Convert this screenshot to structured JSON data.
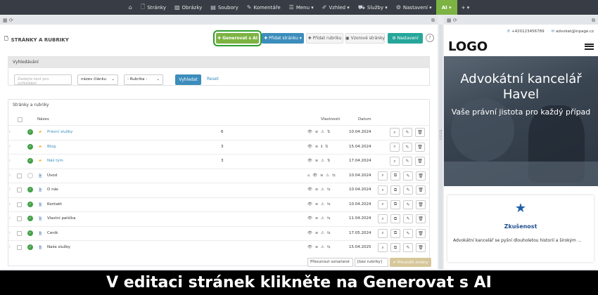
{
  "topbar": {
    "home_icon": "home-icon",
    "items": [
      {
        "label": "Stránky",
        "icon": "file-icon"
      },
      {
        "label": "Obrázky",
        "icon": "image-icon"
      },
      {
        "label": "Soubory",
        "icon": "folder-icon"
      },
      {
        "label": "Komentáře",
        "icon": "comment-icon"
      },
      {
        "label": "Menu ▾",
        "icon": "menu-icon"
      },
      {
        "label": "Vzhled ▾",
        "icon": "brush-icon"
      },
      {
        "label": "Služby ▾",
        "icon": "truck-icon"
      },
      {
        "label": "Nastavení ▾",
        "icon": "gear-icon"
      },
      {
        "label": "AI ▾",
        "icon": ""
      },
      {
        "label": "+ ▾",
        "icon": ""
      }
    ]
  },
  "page": {
    "title": "STRÁNKY A RUBRIKY",
    "buttons": {
      "generate": "✚ Generovat s AI",
      "add_page": "✚ Přidat stránku ▾",
      "add_rubric": "✚ Přidat rubriku",
      "templates": "▣ Vzorové stránky",
      "settings": "⚙ Nastavení",
      "help": "?"
    }
  },
  "search": {
    "heading": "Vyhledávání",
    "placeholder": "Zadejte text pro vyhledání",
    "field": "název článku",
    "rubric": "- Rubrika -",
    "submit": "Vyhledat",
    "reset": "Reset"
  },
  "table": {
    "heading": "Stránky a rubriky",
    "col_name": "Název",
    "col_props": "Vlastnosti",
    "col_date": "Datum",
    "rows": [
      {
        "type": "folder",
        "name": "Právní služby",
        "count": "6",
        "date": "10.04.2024",
        "props": "👁 ≡ ⚠ ⇅",
        "active": true,
        "check": false,
        "acts": 4
      },
      {
        "type": "folder",
        "name": "Blog",
        "count": "3",
        "date": "15.04.2024",
        "props": "👁 ≡ ℹ ⇅",
        "active": true,
        "check": false,
        "acts": 4
      },
      {
        "type": "folder",
        "name": "Náš tým",
        "count": "3",
        "date": "17.04.2024",
        "props": "👁 ≡ ⚠ ⇅",
        "active": true,
        "check": false,
        "acts": 4
      },
      {
        "type": "file",
        "name": "Úvod",
        "count": "",
        "date": "10.04.2024",
        "props": "⌂ 👁 ≡ ⚠ ⇆",
        "active": false,
        "check": true,
        "acts": 5
      },
      {
        "type": "file",
        "name": "O nás",
        "count": "",
        "date": "10.04.2024",
        "props": "👁 ≡ ⚠ ⇆",
        "active": true,
        "check": true,
        "acts": 5
      },
      {
        "type": "file",
        "name": "Kontakt",
        "count": "",
        "date": "10.04.2024",
        "props": "👁 ≡ ⚠ ⇆",
        "active": true,
        "check": true,
        "acts": 5
      },
      {
        "type": "file",
        "name": "Vlastní patička",
        "count": "",
        "date": "11.04.2024",
        "props": "👁 ≡ ⚠ ⇆",
        "active": true,
        "check": true,
        "acts": 5
      },
      {
        "type": "file",
        "name": "Ceník",
        "count": "",
        "date": "17.05.2024",
        "props": "👁 ≡ ⚠ ⇆",
        "active": true,
        "check": true,
        "acts": 5
      },
      {
        "type": "file",
        "name": "Naše služby",
        "count": "",
        "date": "15.04.2025",
        "props": "👁 ≡ ⚠ ⇆",
        "active": true,
        "check": true,
        "acts": 5
      }
    ],
    "move_label": "Přesunout označené",
    "move_target": "[bez rubriky]",
    "save_order": "✔ Přeuložit změny"
  },
  "preview": {
    "phone": "+420123456789",
    "email": "advokat@inpage.cz",
    "logo": "LOGO",
    "hero_title": "Advokátní kancelář Havel",
    "hero_subtitle": "Vaše právní jistota pro každý případ",
    "card_title": "Zkušenost",
    "card_text": "Advokátní kancelář se pyšní dlouholetou historií a širokým ..."
  },
  "caption": "V editaci stránek klikněte na Generovat s AI",
  "colors": {
    "accent": "#7cb342",
    "primary": "#3c8dbc",
    "topbar": "#383d45",
    "teal": "#26a69a"
  }
}
